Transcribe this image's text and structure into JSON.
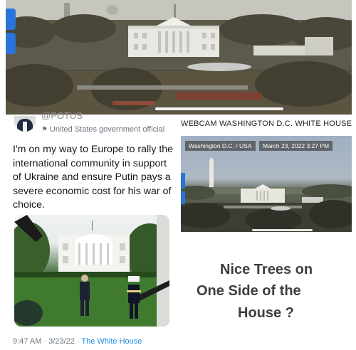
{
  "tweet": {
    "handle": "@POTUS",
    "account_label": "United States government official",
    "text": "I'm on my way to Europe to rally the international community in support of Ukraine and ensure Putin pays a severe economic cost for his war of choice.",
    "timestamp": "9:47 AM · 3/23/22 · ",
    "source": "The White House"
  },
  "webcam": {
    "title": "WEBCAM WASHINGTON D.C. WHITE HOUSE LIVE S",
    "location_tag": "Washington D.C. / USA",
    "datetime_tag": "March 23, 2022 3:27 PM"
  },
  "comment": {
    "line1": "Nice Trees on",
    "line2": "One Side of the",
    "line3": "House ?"
  },
  "colors": {
    "link_blue": "#1d8de0",
    "accent_blue": "#2a73d9",
    "comment_text": "#3e3e3e"
  },
  "icons": {
    "gov_label": "flag-icon"
  }
}
